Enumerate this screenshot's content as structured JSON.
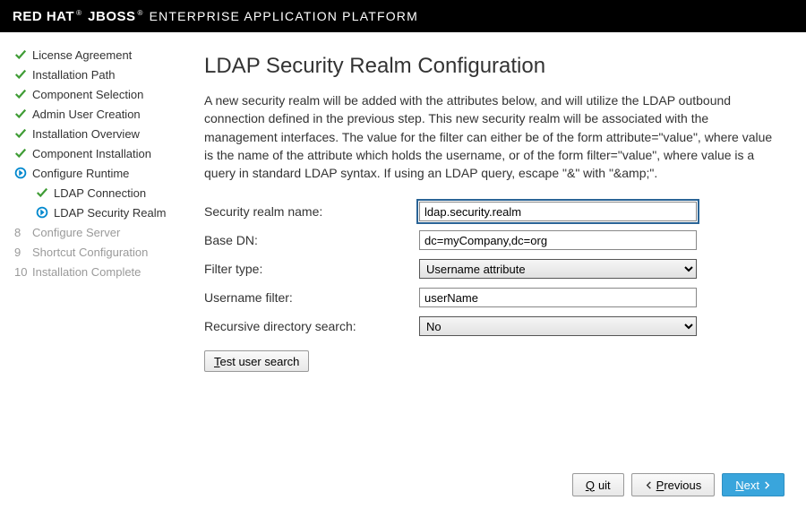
{
  "header": {
    "brand_red": "RED HAT",
    "brand_jboss": "JBOSS",
    "brand_rest": "ENTERPRISE APPLICATION PLATFORM",
    "reg": "®"
  },
  "sidebar": {
    "items": [
      {
        "label": "License Agreement",
        "state": "done"
      },
      {
        "label": "Installation Path",
        "state": "done"
      },
      {
        "label": "Component Selection",
        "state": "done"
      },
      {
        "label": "Admin User Creation",
        "state": "done"
      },
      {
        "label": "Installation Overview",
        "state": "done"
      },
      {
        "label": "Component Installation",
        "state": "done"
      },
      {
        "label": "Configure Runtime",
        "state": "current"
      },
      {
        "label": "LDAP Connection",
        "state": "sub-done"
      },
      {
        "label": "LDAP Security Realm",
        "state": "sub-current"
      },
      {
        "label": "Configure Server",
        "state": "pending",
        "num": "8"
      },
      {
        "label": "Shortcut Configuration",
        "state": "pending",
        "num": "9"
      },
      {
        "label": "Installation Complete",
        "state": "pending",
        "num": "10"
      }
    ]
  },
  "page": {
    "title": "LDAP Security Realm Configuration",
    "desc": "A new security realm will be added with the attributes below, and will utilize the LDAP outbound connection defined in the previous step. This new security realm will be associated with the management interfaces. The value for the filter can either be of the form attribute=\"value\", where value is the name of the attribute which holds the username, or of the form filter=\"value\", where value is a query in standard LDAP syntax. If using an LDAP query, escape \"&\" with \"&amp;\"."
  },
  "form": {
    "realm_label": "Security realm name:",
    "realm_value": "ldap.security.realm",
    "basedn_label": "Base DN:",
    "basedn_value": "dc=myCompany,dc=org",
    "filtertype_label": "Filter type:",
    "filtertype_value": "Username attribute",
    "userfilter_label": "Username filter:",
    "userfilter_value": "userName",
    "recursive_label": "Recursive directory search:",
    "recursive_value": "No",
    "test_btn": "Test user search",
    "test_btn_ul": "T",
    "test_btn_rest": "est user search"
  },
  "footer": {
    "quit_ul": "Q",
    "quit_rest": "uit",
    "prev_ul": "P",
    "prev_rest": "revious",
    "next_ul": "N",
    "next_rest": "ext"
  }
}
